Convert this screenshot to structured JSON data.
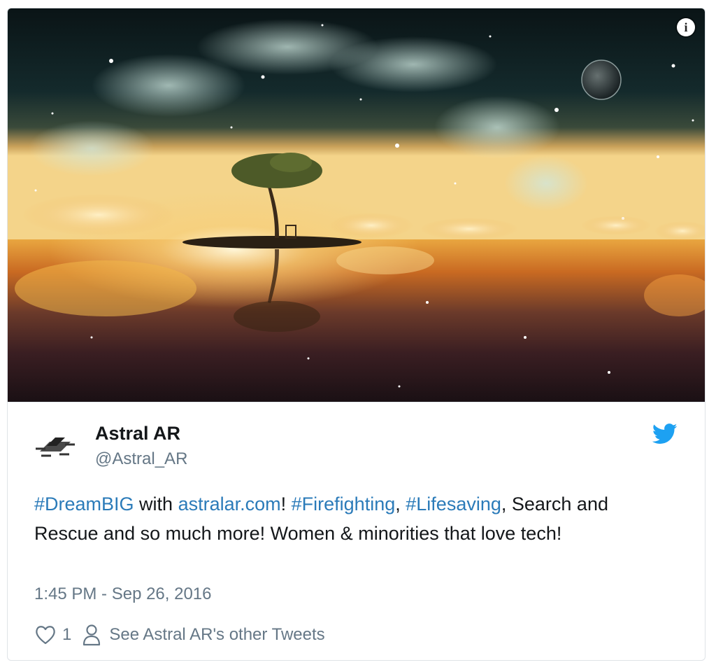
{
  "media": {
    "info_icon": "info-icon",
    "info_glyph": "i"
  },
  "author": {
    "name": "Astral AR",
    "handle": "@Astral_AR",
    "avatar_icon": "drone-avatar-icon",
    "platform_icon": "twitter-bird-icon"
  },
  "tweet": {
    "segments": [
      {
        "text": "#DreamBIG",
        "link": true
      },
      {
        "text": " with ",
        "link": false
      },
      {
        "text": "astralar.com",
        "link": true
      },
      {
        "text": "! ",
        "link": false
      },
      {
        "text": "#Firefighting",
        "link": true
      },
      {
        "text": ", ",
        "link": false
      },
      {
        "text": "#Lifesaving",
        "link": true
      },
      {
        "text": ", Search and Rescue and so much more! Women & minorities that love tech!",
        "link": false
      }
    ],
    "timestamp": "1:45 PM - Sep 26, 2016"
  },
  "actions": {
    "like_icon": "heart-icon",
    "like_count": "1",
    "profile_icon": "person-icon",
    "other_tweets_label": "See Astral AR's other Tweets"
  },
  "colors": {
    "link": "#2b7bb9",
    "muted": "#657786",
    "twitter_blue": "#1da1f2"
  }
}
